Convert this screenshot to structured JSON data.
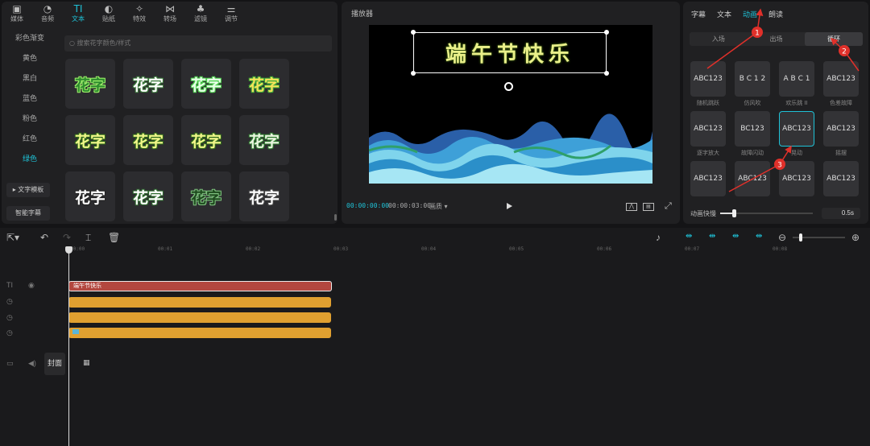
{
  "toolbar": [
    {
      "label": "媒体",
      "icon": "media-icon",
      "glyph": "▣"
    },
    {
      "label": "音频",
      "icon": "audio-icon",
      "glyph": "◔"
    },
    {
      "label": "文本",
      "icon": "text-icon",
      "glyph": "TI",
      "active": true
    },
    {
      "label": "贴纸",
      "icon": "sticker-icon",
      "glyph": "◐"
    },
    {
      "label": "特效",
      "icon": "effects-icon",
      "glyph": "✧"
    },
    {
      "label": "转场",
      "icon": "transition-icon",
      "glyph": "⋈"
    },
    {
      "label": "滤镜",
      "icon": "filter-icon",
      "glyph": "♣"
    },
    {
      "label": "调节",
      "icon": "adjust-icon",
      "glyph": "⚌"
    }
  ],
  "categories": {
    "items": [
      {
        "label": "彩色渐变"
      },
      {
        "label": "黄色"
      },
      {
        "label": "黑白"
      },
      {
        "label": "蓝色"
      },
      {
        "label": "粉色"
      },
      {
        "label": "红色"
      },
      {
        "label": "绿色",
        "active": true
      }
    ],
    "template_button": "▸ 文字模板",
    "smart_subtitle_button": "智能字幕"
  },
  "search": {
    "placeholder": "搜索花字颜色/样式"
  },
  "flower_text": {
    "tile_text": "花字",
    "tiles": [
      {
        "color": "#2e8b2e",
        "stroke": "#9ef06a"
      },
      {
        "color": "#ffffff",
        "stroke": "#3a7a3a"
      },
      {
        "color": "#e8ffe8",
        "stroke": "#4cd04c"
      },
      {
        "color": "#f5e35a",
        "stroke": "#3aa83a"
      },
      {
        "color": "#f2f78a",
        "stroke": "#2e6a1a"
      },
      {
        "color": "#f2f78a",
        "stroke": "#2e6a1a"
      },
      {
        "color": "#f2f78a",
        "stroke": "#2e6a1a"
      },
      {
        "color": "#eaf6e0",
        "stroke": "#2e7a2e"
      },
      {
        "color": "#ffffff",
        "stroke": "#222222"
      },
      {
        "color": "#ffffff",
        "stroke": "#2e6a2e"
      },
      {
        "color": "#1e4a1e",
        "stroke": "#7ec07e"
      },
      {
        "color": "#ffffff",
        "stroke": "#444444"
      }
    ]
  },
  "player": {
    "header": "播放器",
    "title_text": "端午节快乐",
    "current_time": "00:00:00:00",
    "total_time": "00:00:03:00",
    "ratio_label": "画质 ▾",
    "play_icon": "play-icon"
  },
  "right_panel": {
    "tabs": [
      {
        "label": "字幕"
      },
      {
        "label": "文本"
      },
      {
        "label": "动画",
        "active": true
      },
      {
        "label": "朗读"
      }
    ],
    "segments": [
      {
        "label": "入场"
      },
      {
        "label": "出场"
      },
      {
        "label": "循环",
        "active": true
      }
    ],
    "animations": [
      {
        "label": "随机跳跃",
        "sample": "ABC123"
      },
      {
        "label": "仿风吹",
        "sample": "B C 1 2"
      },
      {
        "label": "欢乐跳 II",
        "sample": "A B C 1"
      },
      {
        "label": "色差故障",
        "sample": "ABC123"
      },
      {
        "label": "逐字放大",
        "sample": "ABC123"
      },
      {
        "label": "故障闪动",
        "sample": "BC123"
      },
      {
        "label": "晃动",
        "sample": "ABC123",
        "selected": true
      },
      {
        "label": "摇摆",
        "sample": "ABC123"
      },
      {
        "label": "",
        "sample": "ABC123"
      },
      {
        "label": "",
        "sample": "ABC123"
      },
      {
        "label": "",
        "sample": "ABC123"
      },
      {
        "label": "",
        "sample": "ABC123"
      }
    ],
    "speed_label": "动画快慢",
    "speed_value": "0.5s",
    "speed_fraction": 0.15
  },
  "annotations": [
    "1",
    "2",
    "3"
  ],
  "timeline": {
    "ticks": [
      "00:00",
      "00:01",
      "00:02",
      "00:03",
      "00:04",
      "00:05",
      "00:06",
      "00:07",
      "00:08"
    ],
    "text_clip": "端午节快乐",
    "cover_label": "封面"
  },
  "colors": {
    "accent": "#1fc1d6",
    "text_clip": "#b3473f",
    "effect_clip": "#e0a030",
    "annotation": "#e0302a"
  }
}
